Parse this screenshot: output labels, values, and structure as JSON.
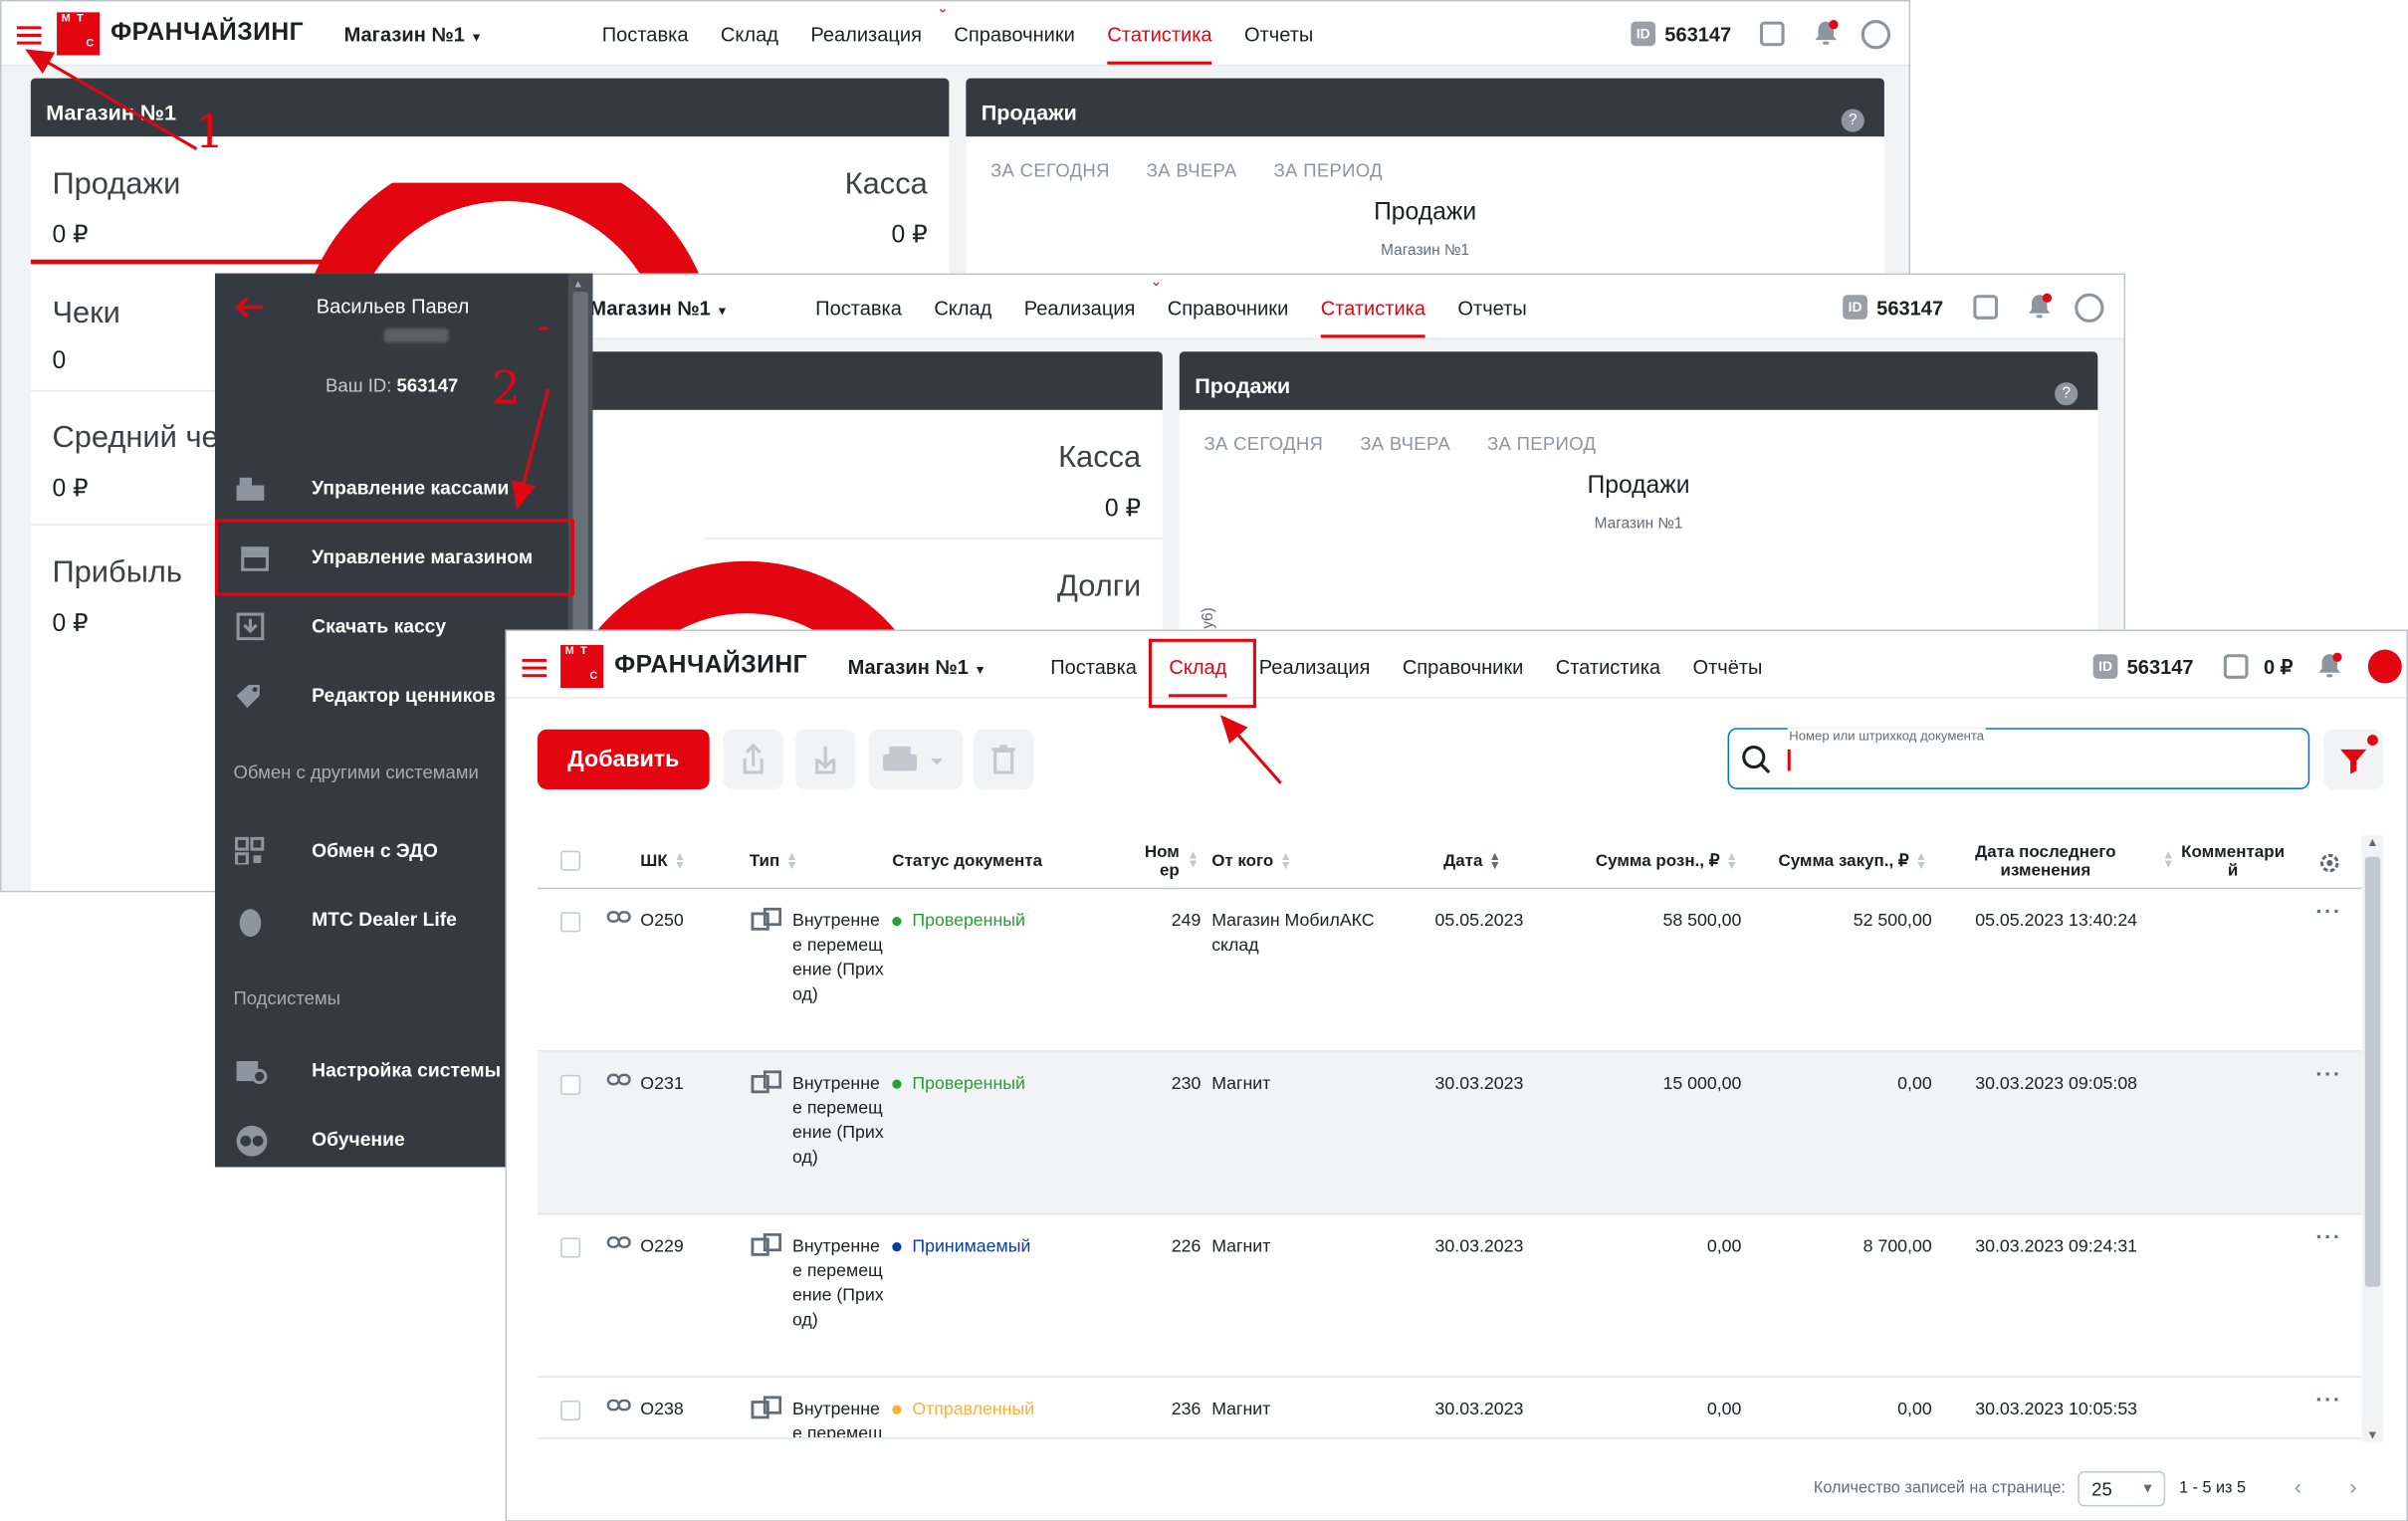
{
  "colors": {
    "brand": "#e30611",
    "dark": "#343a40",
    "green": "#26a035",
    "blue": "#0c3ba3",
    "orange": "#fcb034"
  },
  "app": {
    "brand": "ФРАНЧАЙЗИНГ",
    "logo_letters": [
      "М",
      "Т",
      "С"
    ],
    "store": "Магазин №1",
    "user_id": "563147",
    "balance": "0 ₽"
  },
  "nav_old": [
    "Поставка",
    "Склад",
    "Реализация",
    "Справочники",
    "Статистика",
    "Отчеты"
  ],
  "nav_new": [
    "Поставка",
    "Склад",
    "Реализация",
    "Справочники",
    "Статистика",
    "Отчёты"
  ],
  "dashboard": {
    "store_panel": "Магазин №1",
    "sales": "Продажи",
    "sales_val": "0 ₽",
    "cash": "Касса",
    "cash_val": "0 ₽",
    "checks": "Чеки",
    "checks_val": "0",
    "avg": "Средний че",
    "avg_val": "0 ₽",
    "profit": "Прибыль",
    "profit_val": "0 ₽",
    "debts": "Долги",
    "sales_panel": "Продажи",
    "tab_today": "ЗА СЕГОДНЯ",
    "tab_yesterday": "ЗА ВЧЕРА",
    "tab_period": "ЗА ПЕРИОД",
    "chart_title": "Продажи",
    "chart_sub": "Магазин №1",
    "axis_fragment": "у6)"
  },
  "sidebar": {
    "user": "Васильев Павел",
    "id_label": "Ваш ID:",
    "id": "563147",
    "items": [
      {
        "label": "Управление кассами",
        "icon": "cash-register-icon"
      },
      {
        "label": "Управление магазином",
        "icon": "store-icon"
      },
      {
        "label": "Скачать кассу",
        "icon": "download-icon"
      },
      {
        "label": "Редактор ценников",
        "icon": "price-tag-icon"
      },
      {
        "label": "Обмен с ЭДО",
        "icon": "qr-code-icon"
      },
      {
        "label": "МТС Dealer Life",
        "icon": "egg-icon"
      },
      {
        "label": "Настройка системы",
        "icon": "settings-icon"
      },
      {
        "label": "Обучение",
        "icon": "owl-icon"
      }
    ],
    "section_exchange": "Обмен с другими системами",
    "section_subsystems": "Подсистемы"
  },
  "toolbar": {
    "add": "Добавить",
    "search_label": "Номер или штрихкод документа",
    "search_value": ""
  },
  "table": {
    "headers": {
      "shk": "ШК",
      "type": "Тип",
      "status": "Статус документа",
      "num": "Номер",
      "from": "От кого",
      "date": "Дата",
      "retail": "Сумма розн., ₽",
      "purchase": "Сумма закуп., ₽",
      "changed": "Дата последнего изменения",
      "comment": "Комментарий"
    },
    "rows": [
      {
        "shk": "О250",
        "type": "Внутреннее перемещение (Приход)",
        "status": "Проверенный",
        "status_color": "green",
        "num": "249",
        "from": "Магазин МобилАКС склад",
        "date": "05.05.2023",
        "retail": "58 500,00",
        "purchase": "52 500,00",
        "changed": "05.05.2023 13:40:24"
      },
      {
        "shk": "О231",
        "type": "Внутреннее перемещение (Приход)",
        "status": "Проверенный",
        "status_color": "green",
        "num": "230",
        "from": "Магнит",
        "date": "30.03.2023",
        "retail": "15 000,00",
        "purchase": "0,00",
        "changed": "30.03.2023 09:05:08"
      },
      {
        "shk": "О229",
        "type": "Внутреннее перемещение (Приход)",
        "status": "Принимаемый",
        "status_color": "blue",
        "num": "226",
        "from": "Магнит",
        "date": "30.03.2023",
        "retail": "0,00",
        "purchase": "8 700,00",
        "changed": "30.03.2023 09:24:31"
      },
      {
        "shk": "О238",
        "type": "Внутреннее перемещение (Приход)",
        "status": "Отправленный",
        "status_color": "orange",
        "num": "236",
        "from": "Магнит",
        "date": "30.03.2023",
        "retail": "0,00",
        "purchase": "0,00",
        "changed": "30.03.2023 10:05:53"
      }
    ]
  },
  "pagination": {
    "label": "Количество записей на странице:",
    "per_page": "25",
    "range": "1 - 5 из 5"
  },
  "annotations": {
    "n1": "1",
    "n2": "2"
  }
}
